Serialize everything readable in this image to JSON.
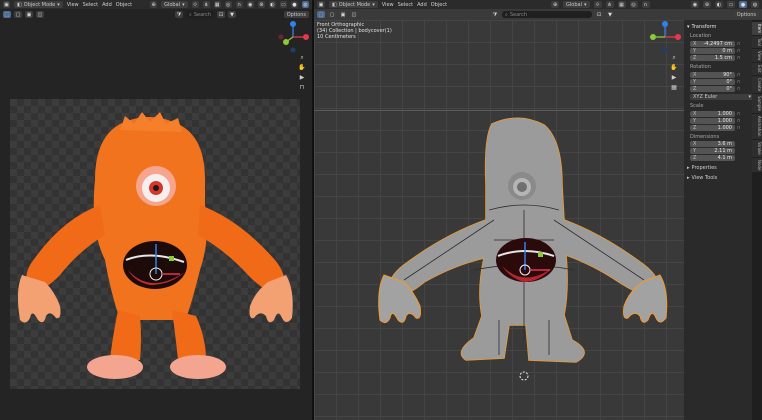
{
  "left": {
    "header": {
      "editor_icon": "3d-viewport-icon",
      "mode": "Object Mode",
      "menus": [
        "View",
        "Select",
        "Add",
        "Object"
      ],
      "pivot_value": "Global",
      "options_label": "Options"
    },
    "toolbar": {
      "search_placeholder": "Search"
    }
  },
  "right": {
    "header": {
      "editor_icon": "3d-viewport-icon",
      "mode": "Object Mode",
      "menus": [
        "View",
        "Select",
        "Add",
        "Object"
      ],
      "pivot_value": "Global",
      "options_label": "Options"
    },
    "toolbar": {
      "search_placeholder": "Search"
    },
    "view_info": {
      "line1": "Front Orthographic",
      "line2": "(34) Collection | bodycover(1)",
      "line3": "10 Centimeters"
    }
  },
  "npanel": {
    "transform_title": "Transform",
    "location_label": "Location",
    "location": [
      {
        "axis": "X",
        "value": "-4.2497 cm"
      },
      {
        "axis": "Y",
        "value": "0 m"
      },
      {
        "axis": "Z",
        "value": "1.5 cm"
      }
    ],
    "rotation_label": "Rotation",
    "rotation": [
      {
        "axis": "X",
        "value": "90°"
      },
      {
        "axis": "Y",
        "value": "0°"
      },
      {
        "axis": "Z",
        "value": "0°"
      }
    ],
    "rotation_mode": "XYZ Euler",
    "scale_label": "Scale",
    "scale": [
      {
        "axis": "X",
        "value": "1.000"
      },
      {
        "axis": "Y",
        "value": "1.000"
      },
      {
        "axis": "Z",
        "value": "1.000"
      }
    ],
    "dimensions_label": "Dimensions",
    "dimensions": [
      {
        "axis": "X",
        "value": "3.6 m"
      },
      {
        "axis": "Y",
        "value": "2.11 m"
      },
      {
        "axis": "Z",
        "value": "4.1 m"
      }
    ],
    "properties_label": "Properties",
    "view_tools_label": "View Tools"
  },
  "tabs": [
    "Item",
    "Tool",
    "View",
    "Edit",
    "Create",
    "Sample",
    "Animation",
    "Stroke",
    "Node"
  ],
  "colors": {
    "active_tab": "#3f3f3f",
    "accent": "#4d6b93",
    "gizmo_x": "#e8364f",
    "gizmo_y": "#8acb38",
    "gizmo_z": "#2f83e8",
    "monster_orange": "#f2731d",
    "monster_gray": "#9b9b9b",
    "selection_outline": "#f29a2b"
  }
}
